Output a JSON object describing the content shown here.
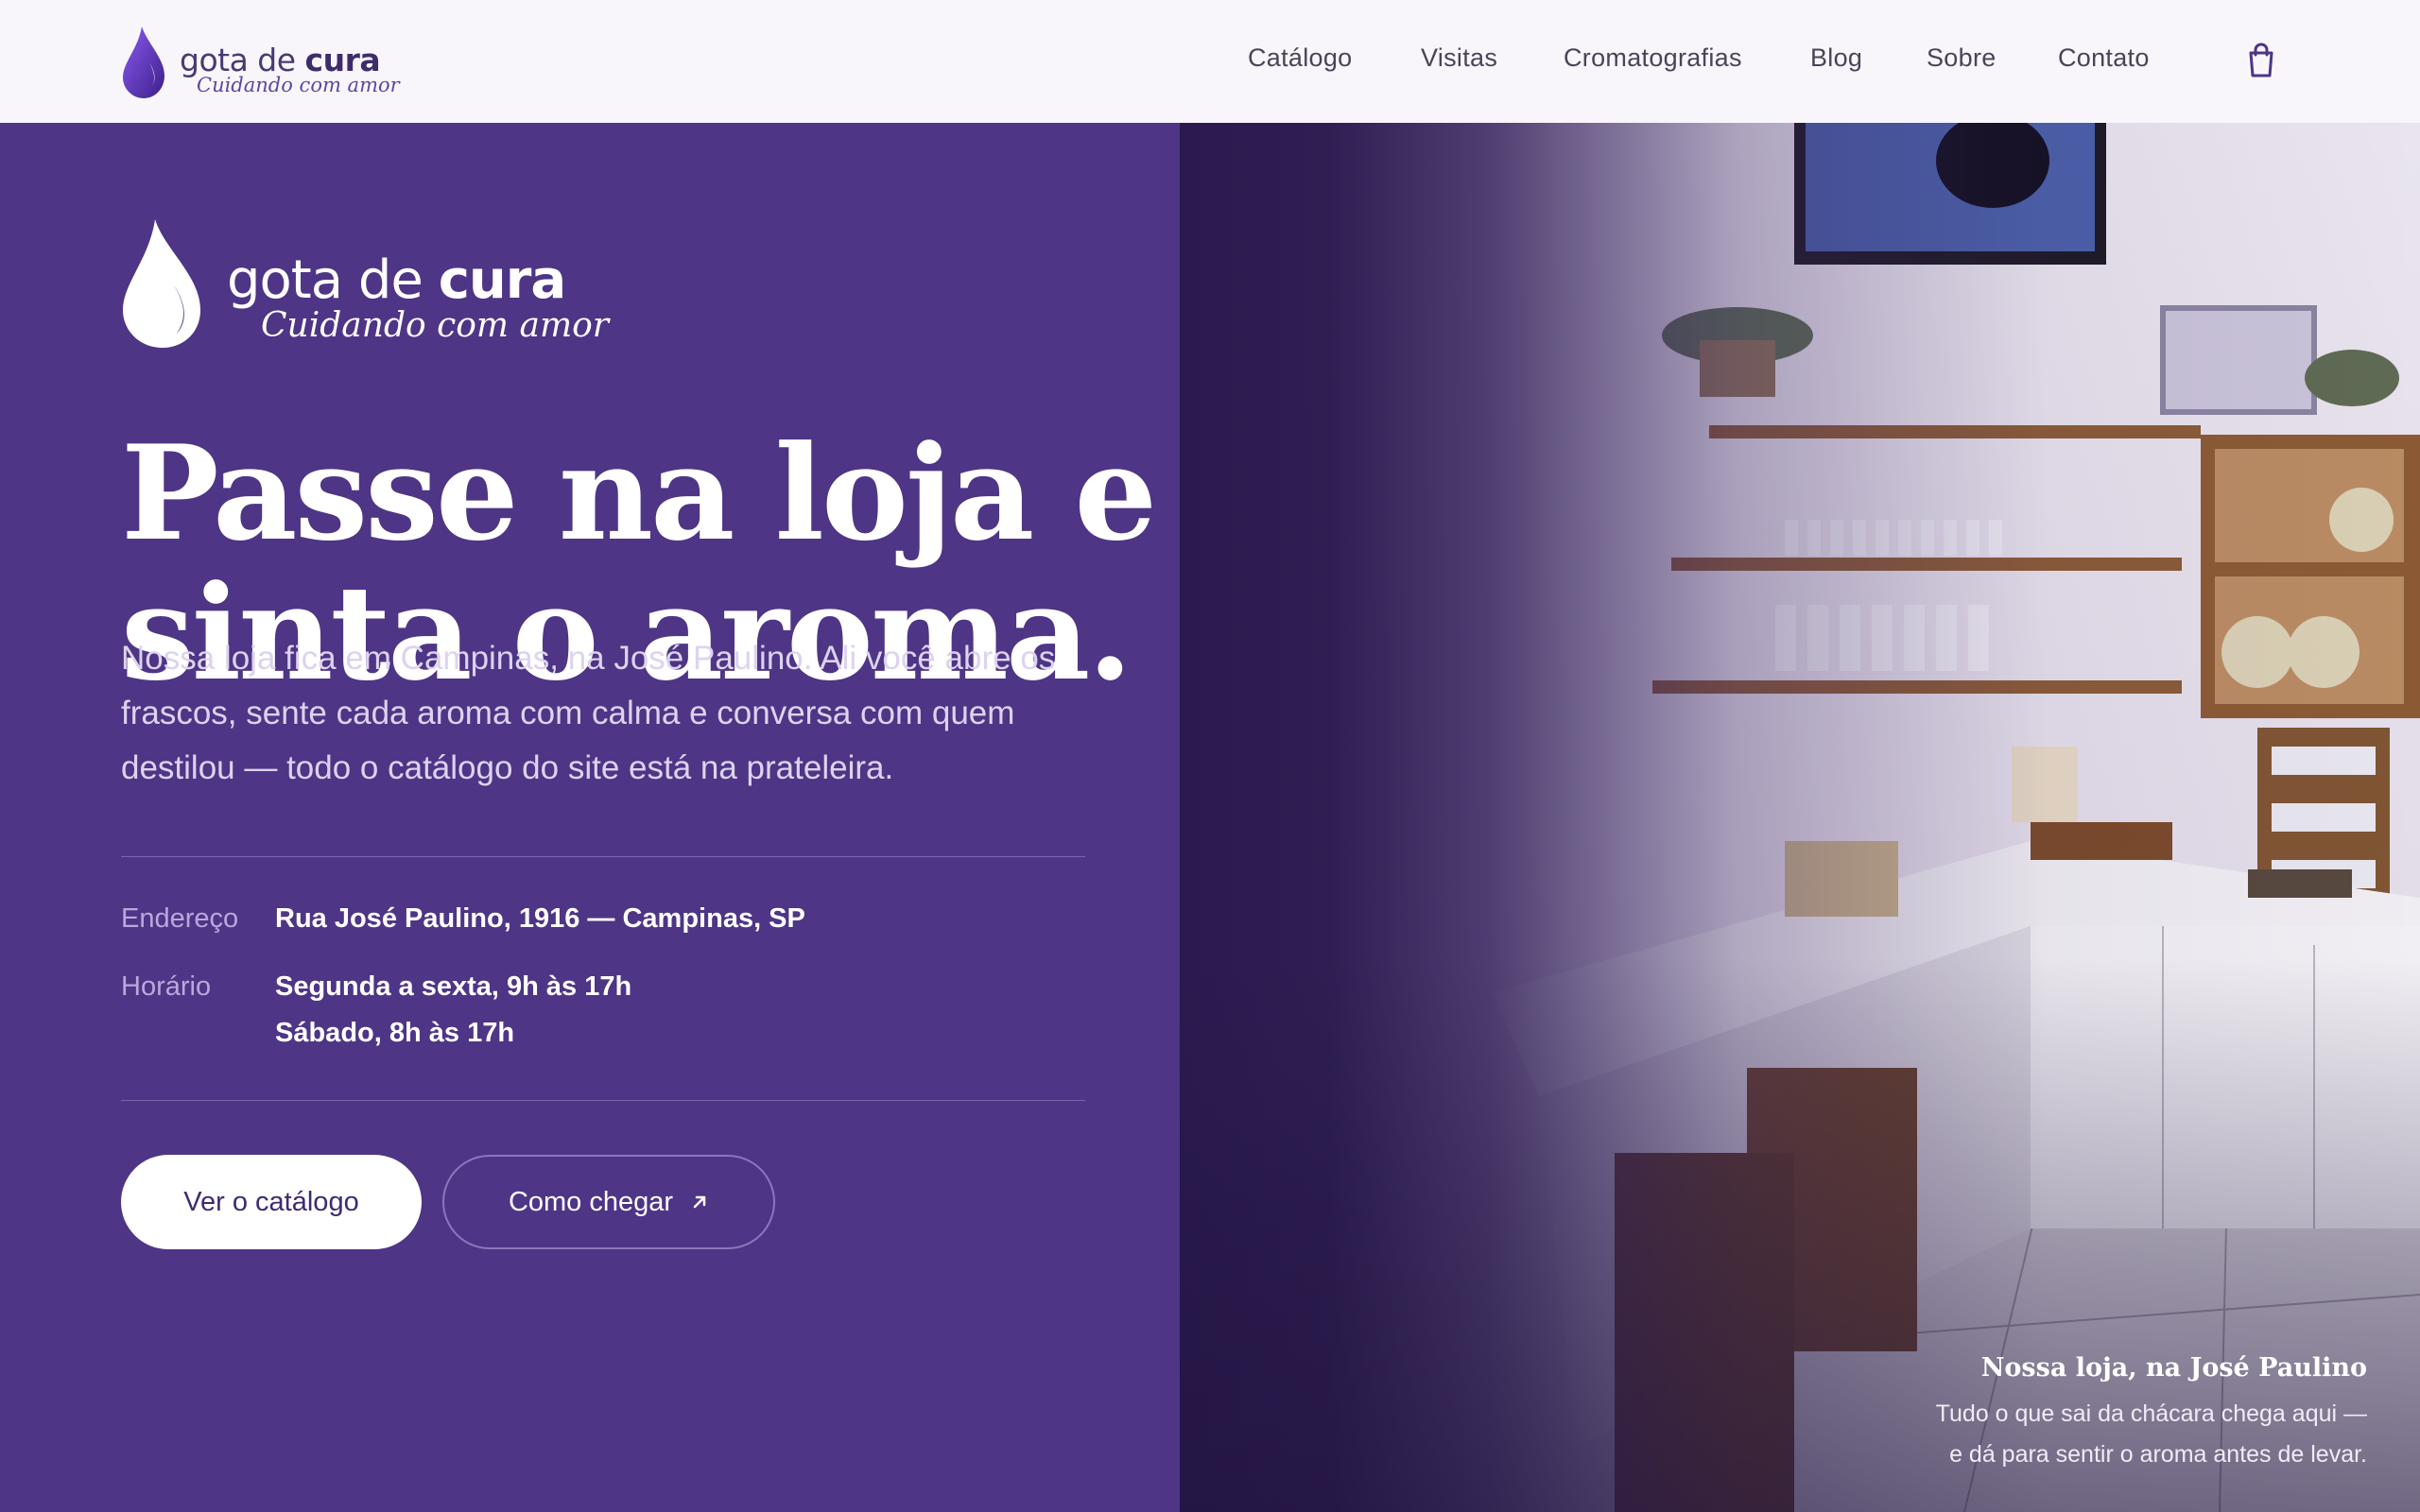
{
  "brand": {
    "name_light": "gota de",
    "name_bold": "cura",
    "tagline": "Cuidando com amor",
    "primary_color": "#4e3586",
    "logo_icon": "drop-icon"
  },
  "nav": {
    "items": [
      "Catálogo",
      "Visitas",
      "Cromatografias",
      "Blog",
      "Sobre",
      "Contato"
    ],
    "cart_icon": "shopping-bag-icon"
  },
  "hero": {
    "headline_line1": "Passe na loja e",
    "headline_line2": "sinta o aroma.",
    "intro": "Nossa loja fica em Campinas, na José Paulino. Ali você abre os frascos, sente cada aroma com calma e conversa com quem destilou — todo o catálogo do site está na prateleira.",
    "address_label": "Endereço",
    "address_value": "Rua José Paulino, 1916 — Campinas, SP",
    "hours_label": "Horário",
    "hours_weekdays": "Segunda a sexta, 9h às 17h",
    "hours_saturday": "Sábado, 8h às 17h",
    "cta_primary": "Ver o catálogo",
    "cta_secondary": "Como chegar",
    "cta_secondary_icon": "arrow-up-right-icon"
  },
  "photo": {
    "caption_title": "Nossa loja, na José Paulino",
    "caption_text": "Tudo o que sai da chácara chega aqui — e dá para sentir o aroma antes de levar."
  }
}
